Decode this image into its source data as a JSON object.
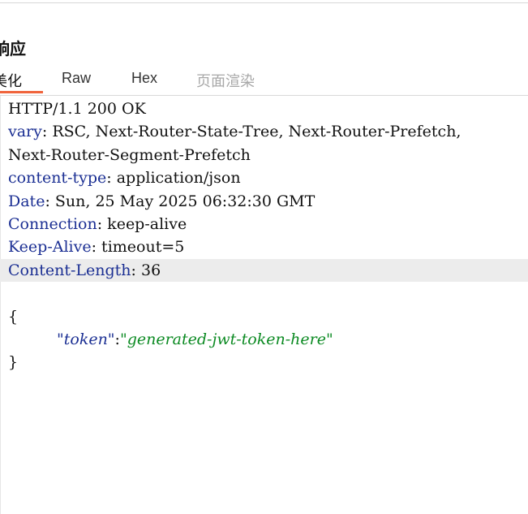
{
  "panel": {
    "title": "响应"
  },
  "tabs": [
    {
      "label": "美化"
    },
    {
      "label": "Raw"
    },
    {
      "label": "Hex"
    },
    {
      "label": "页面渲染"
    }
  ],
  "response": {
    "status_line": "HTTP/1.1 200 OK",
    "headers": [
      {
        "name": "vary",
        "value": " RSC, Next-Router-State-Tree, Next-Router-Prefetch,"
      },
      {
        "name": "",
        "value": "Next-Router-Segment-Prefetch"
      },
      {
        "name": "content-type",
        "value": " application/json"
      },
      {
        "name": "Date",
        "value": " Sun, 25 May 2025 06:32:30 GMT"
      },
      {
        "name": "Connection",
        "value": " keep-alive"
      },
      {
        "name": "Keep-Alive",
        "value": " timeout=5"
      },
      {
        "name": "Content-Length",
        "value": " 36"
      }
    ],
    "body": {
      "open": "{",
      "key": "\"token\"",
      "colon": ":",
      "value": "\"generated-jwt-token-here\"",
      "close": "}"
    }
  },
  "colors": {
    "header_name": "#1b2f93",
    "string_value": "#0b8a22",
    "active_tab_underline": "#f0643c",
    "highlight_row": "#ececec"
  }
}
